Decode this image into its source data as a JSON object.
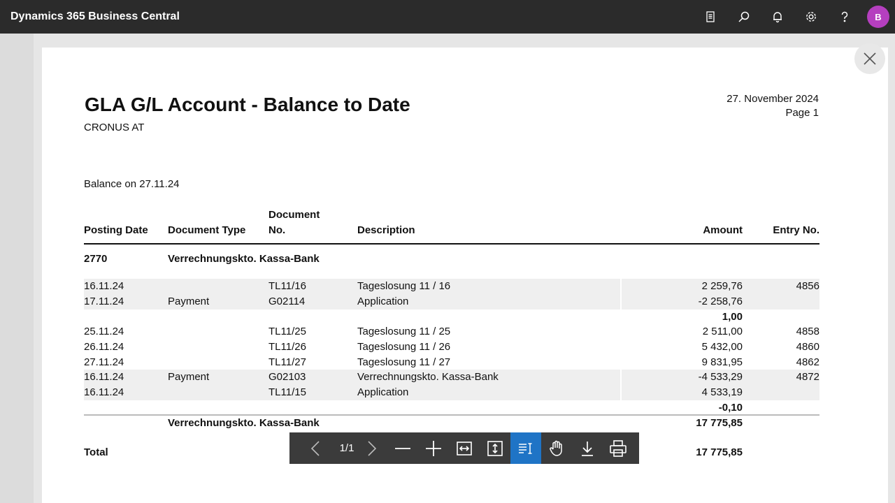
{
  "app": {
    "title": "Dynamics 365 Business Central",
    "user_initial": "B",
    "icons": [
      "report-icon",
      "search-icon",
      "bell-icon",
      "gear-icon",
      "help-icon"
    ]
  },
  "report": {
    "title": "GLA G/L Account - Balance to Date",
    "company": "CRONUS AT",
    "date": "27. November 2024",
    "page": "Page 1",
    "balance_on": "Balance on 27.11.24",
    "columns": {
      "posting_date": "Posting Date",
      "document_type": "Document Type",
      "document_no_line1": "Document",
      "document_no_line2": "No.",
      "description": "Description",
      "amount": "Amount",
      "entry_no": "Entry No."
    },
    "group": {
      "account_no": "2770",
      "account_name": "Verrechnungskto. Kassa-Bank"
    },
    "rows": [
      {
        "date": "16.11.24",
        "type": "",
        "doc": "TL11/16",
        "desc": "Tageslosung 11 / 16",
        "amount": "2 259,76",
        "entry": "4856"
      },
      {
        "date": "17.11.24",
        "type": "Payment",
        "doc": "G02114",
        "desc": "Application",
        "amount": "-2 258,76",
        "entry": ""
      },
      {
        "date": "",
        "type": "",
        "doc": "",
        "desc": "",
        "amount": "1,00",
        "entry": ""
      },
      {
        "date": "25.11.24",
        "type": "",
        "doc": "TL11/25",
        "desc": "Tageslosung 11 / 25",
        "amount": "2 511,00",
        "entry": "4858"
      },
      {
        "date": "26.11.24",
        "type": "",
        "doc": "TL11/26",
        "desc": "Tageslosung 11 / 26",
        "amount": "5 432,00",
        "entry": "4860"
      },
      {
        "date": "27.11.24",
        "type": "",
        "doc": "TL11/27",
        "desc": "Tageslosung 11 / 27",
        "amount": "9 831,95",
        "entry": "4862"
      },
      {
        "date": "16.11.24",
        "type": "Payment",
        "doc": "G02103",
        "desc": "Verrechnungskto. Kassa-Bank",
        "amount": "-4 533,29",
        "entry": "4872"
      },
      {
        "date": "16.11.24",
        "type": "",
        "doc": "TL11/15",
        "desc": "Application",
        "amount": "4 533,19",
        "entry": ""
      },
      {
        "date": "",
        "type": "",
        "doc": "",
        "desc": "",
        "amount": "-0,10",
        "entry": ""
      }
    ],
    "account_total_label": "Verrechnungskto. Kassa-Bank",
    "account_total_amount": "17 775,85",
    "total_label": "Total",
    "total_amount": "17 775,85"
  },
  "viewer": {
    "page_indicator": "1/1",
    "tools": [
      "previous-page",
      "next-page",
      "zoom-out",
      "zoom-in",
      "fit-width",
      "fit-page",
      "text-select",
      "hand-tool",
      "download",
      "print"
    ],
    "active_tool": "text-select"
  }
}
